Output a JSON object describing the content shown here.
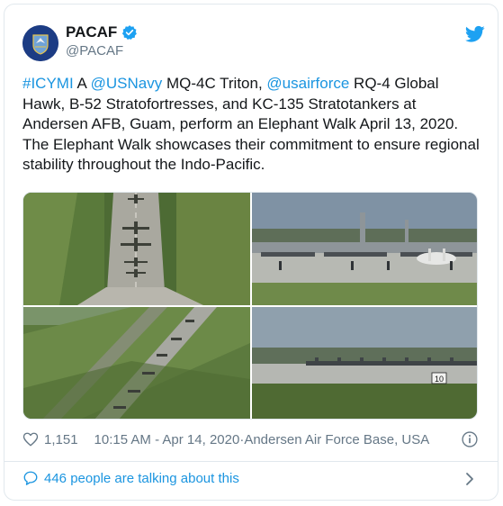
{
  "author": {
    "display_name": "PACAF",
    "handle": "@PACAF",
    "avatar_icon": "pacaf-emblem-icon",
    "verified_icon": "verified-badge-icon"
  },
  "tweet": {
    "hashtag": "#ICYMI",
    "part1": " A ",
    "mention1": "@USNavy",
    "part2": " MQ-4C Triton, ",
    "mention2": "@usairforce",
    "part3": " RQ-4 Global Hawk, B-52 Stratofortresses, and KC-135 Stratotankers at Andersen AFB, Guam, perform an Elephant Walk April 13, 2020. The Elephant Walk showcases their commitment to ensure regional stability throughout the Indo-Pacific."
  },
  "meta": {
    "likes": "1,151",
    "timestamp": "10:15 AM - Apr 14, 2020",
    "separator": " · ",
    "location": "Andersen Air Force Base, USA"
  },
  "footer": {
    "talking_text": "446 people are talking about this"
  },
  "media": {
    "sign_number": "10"
  },
  "colors": {
    "link": "#1b95e0",
    "muted": "#657786",
    "text": "#14171a"
  }
}
